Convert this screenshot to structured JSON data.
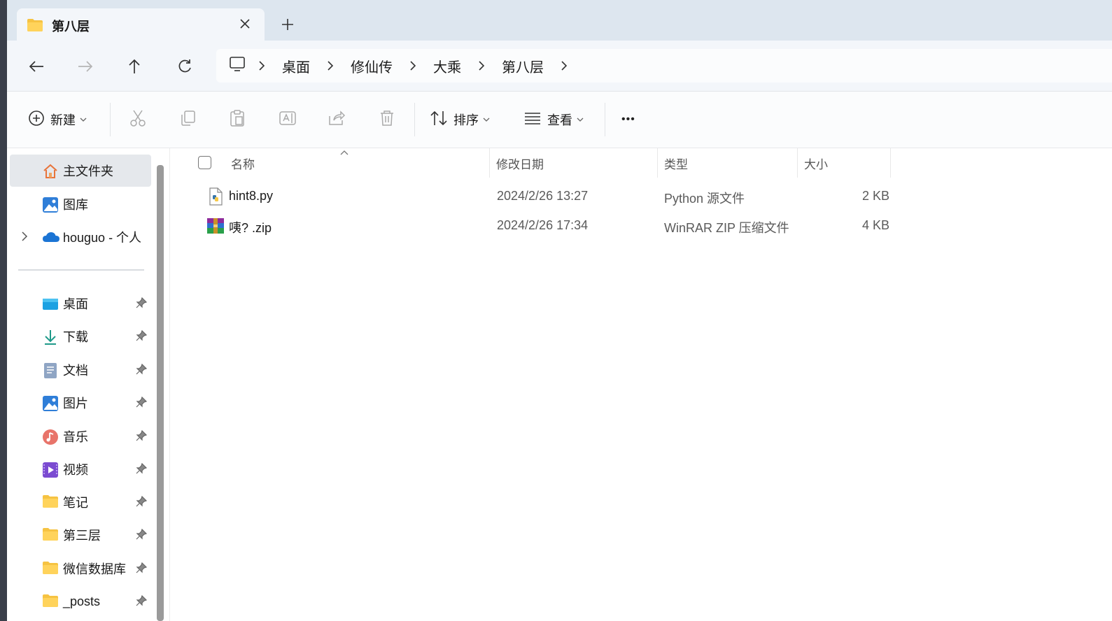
{
  "tab": {
    "title": "第八层",
    "new_tab": "+"
  },
  "address": {
    "crumbs": [
      "桌面",
      "修仙传",
      "大乘",
      "第八层"
    ]
  },
  "toolbar": {
    "new_label": "新建",
    "sort_label": "排序",
    "view_label": "查看",
    "more_label": "•••"
  },
  "sidebar": {
    "top_items": [
      {
        "label": "主文件夹",
        "icon": "home-icon"
      },
      {
        "label": "图库",
        "icon": "gallery-icon"
      },
      {
        "label": "houguo - 个人",
        "icon": "onedrive-cloud-icon"
      }
    ],
    "pinned_items": [
      {
        "label": "桌面",
        "icon": "desktop-icon"
      },
      {
        "label": "下载",
        "icon": "download-icon"
      },
      {
        "label": "文档",
        "icon": "documents-icon"
      },
      {
        "label": "图片",
        "icon": "pictures-icon"
      },
      {
        "label": "音乐",
        "icon": "music-icon"
      },
      {
        "label": "视频",
        "icon": "videos-icon"
      },
      {
        "label": "笔记",
        "icon": "folder-icon"
      },
      {
        "label": "第三层",
        "icon": "folder-icon"
      },
      {
        "label": "微信数据库",
        "icon": "folder-icon"
      },
      {
        "label": "_posts",
        "icon": "folder-icon"
      }
    ]
  },
  "columns": {
    "name": "名称",
    "date": "修改日期",
    "type": "类型",
    "size": "大小"
  },
  "files": [
    {
      "name": "hint8.py",
      "date": "2024/2/26 13:27",
      "type": "Python 源文件",
      "size": "2 KB",
      "icon": "python-file-icon"
    },
    {
      "name": "咦? .zip",
      "date": "2024/2/26 17:34",
      "type": "WinRAR ZIP 压缩文件",
      "size": "4 KB",
      "icon": "winrar-archive-icon"
    }
  ],
  "colors": {
    "accent": "#0067c0",
    "folder": "#f6c342",
    "titlebar": "#dde6ef"
  }
}
